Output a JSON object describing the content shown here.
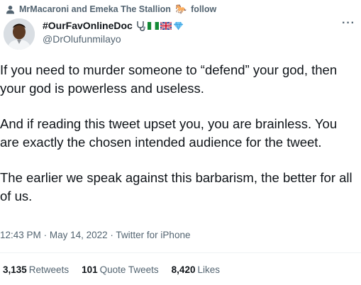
{
  "social_context": {
    "text": "MrMacaroni and Emeka The Stallion",
    "horse_emoji": "🐎",
    "follow_text": "follow"
  },
  "author": {
    "display_name": "#OurFavOnlineDoc",
    "emojis": [
      "stethoscope",
      "nigeria-flag",
      "uk-flag",
      "gem"
    ],
    "handle": "@DrOlufunmilayo"
  },
  "more_label": "···",
  "tweet": {
    "paragraphs": [
      "If you need to murder someone to “defend” your god, then your god is powerless and useless.",
      "And if reading this tweet upset you, you are brainless. You are exactly the chosen intended audience for the tweet.",
      "The earlier we speak against this barbarism, the better for all of us."
    ]
  },
  "meta": {
    "time": "12:43 PM",
    "separator": "·",
    "date": "May 14, 2022",
    "source": "Twitter for iPhone"
  },
  "stats": {
    "retweets_count": "3,135",
    "retweets_label": "Retweets",
    "quotes_count": "101",
    "quotes_label": "Quote Tweets",
    "likes_count": "8,420",
    "likes_label": "Likes"
  },
  "colors": {
    "text_primary": "#0f1419",
    "text_secondary": "#536471",
    "divider": "#eff3f4"
  }
}
